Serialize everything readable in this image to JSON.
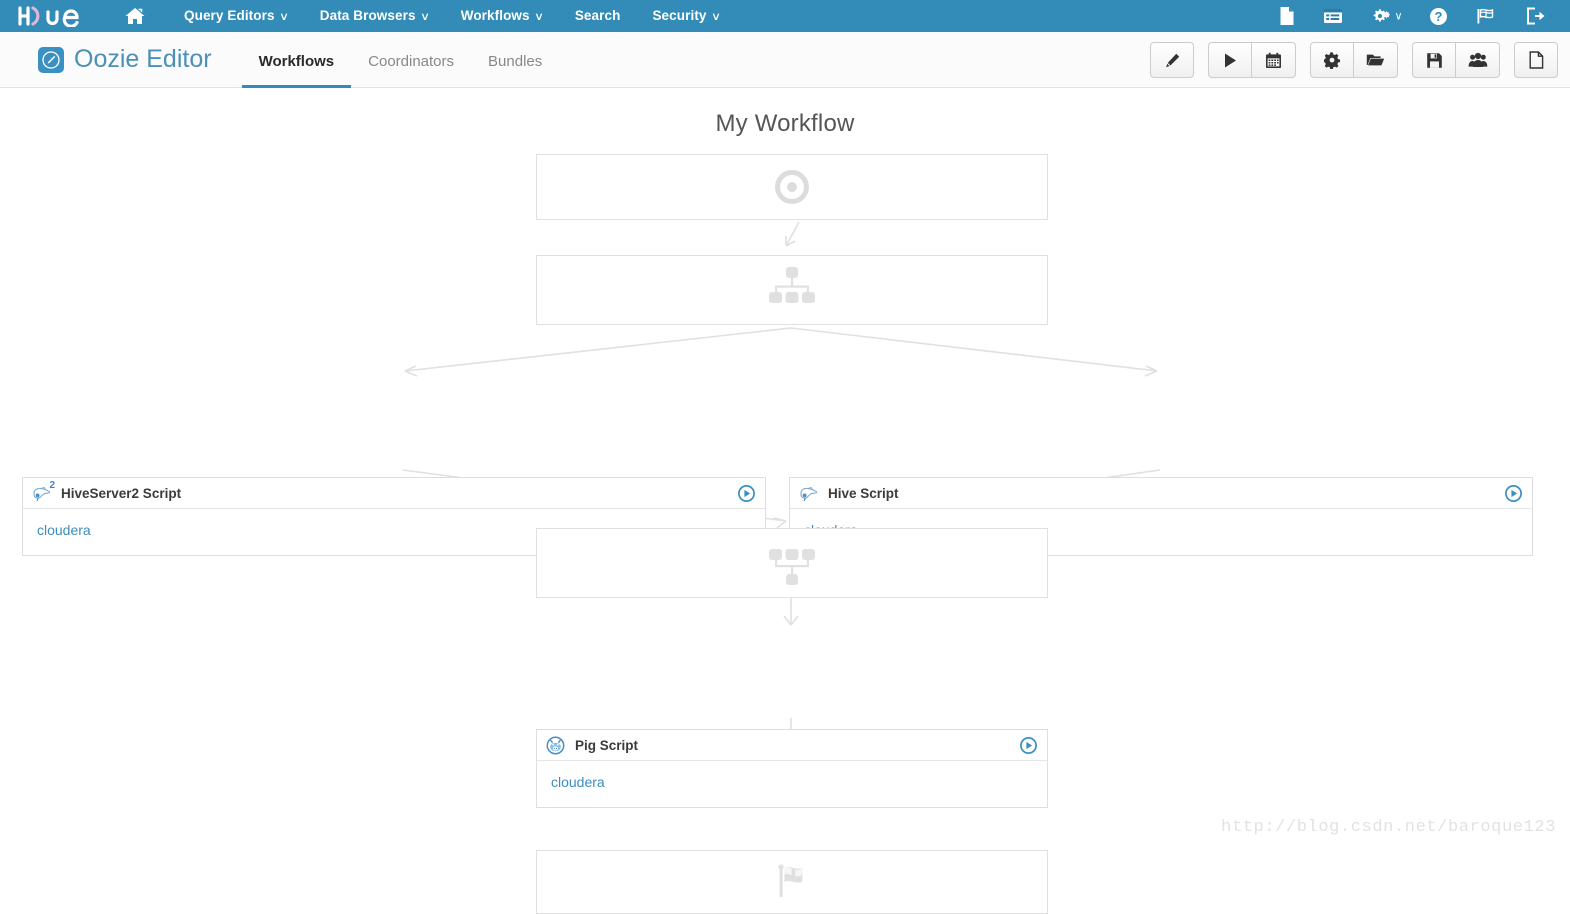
{
  "navbar": {
    "brand_label": "hue",
    "brand_icon": "hue-logo",
    "home_icon": "home-icon",
    "bg_color": "#338bb8",
    "items": [
      {
        "label": "Query Editors",
        "caret": "∨",
        "has_caret": true,
        "icon": "chevron-down-icon"
      },
      {
        "label": "Data Browsers",
        "caret": "∨",
        "has_caret": true,
        "icon": "chevron-down-icon"
      },
      {
        "label": "Workflows",
        "caret": "∨",
        "has_caret": true,
        "icon": "chevron-down-icon"
      },
      {
        "label": "Search",
        "caret": "",
        "has_caret": false,
        "icon": ""
      },
      {
        "label": "Security",
        "caret": "∨",
        "has_caret": true,
        "icon": "chevron-down-icon"
      }
    ],
    "right_icons": [
      {
        "name": "document-icon",
        "title": "Documents"
      },
      {
        "name": "jobs-window-icon",
        "title": "Job Browser"
      },
      {
        "name": "gears-icon",
        "title": "Administration",
        "caret": "∨"
      },
      {
        "name": "help-question-icon",
        "title": "Help"
      },
      {
        "name": "flag-icon",
        "title": "Language"
      },
      {
        "name": "sign-out-icon",
        "title": "Sign out"
      }
    ]
  },
  "subheader": {
    "app_logo_icon": "pencil-square-icon",
    "app_title": "Oozie Editor",
    "app_title_color": "#4a90b8",
    "tabs": [
      {
        "label": "Workflows",
        "active": true
      },
      {
        "label": "Coordinators",
        "active": false
      },
      {
        "label": "Bundles",
        "active": false
      }
    ],
    "toolbar_groups": [
      {
        "buttons": [
          {
            "name": "edit-properties-button",
            "icon": "pencil-icon",
            "label": "Edit"
          }
        ]
      },
      {
        "buttons": [
          {
            "name": "submit-button",
            "icon": "play-icon",
            "label": "Submit"
          },
          {
            "name": "schedule-button",
            "icon": "calendar-icon",
            "label": "Schedule"
          }
        ]
      },
      {
        "buttons": [
          {
            "name": "settings-button",
            "icon": "gear-icon",
            "label": "Settings"
          },
          {
            "name": "open-button",
            "icon": "folder-open-icon",
            "label": "Open"
          }
        ]
      },
      {
        "buttons": [
          {
            "name": "save-button",
            "icon": "floppy-save-icon",
            "label": "Save"
          },
          {
            "name": "share-button",
            "icon": "group-users-icon",
            "label": "Share"
          }
        ]
      },
      {
        "buttons": [
          {
            "name": "new-button",
            "icon": "file-icon",
            "label": "New"
          }
        ]
      }
    ]
  },
  "workflow": {
    "title": "My Workflow",
    "nodes": [
      {
        "id": "start",
        "type": "control",
        "icon": "start-dot-circle-icon",
        "label": ""
      },
      {
        "id": "fork",
        "type": "control",
        "icon": "fork-sitemap-icon",
        "label": ""
      },
      {
        "id": "hiveserver2",
        "type": "action",
        "icon": "hive-server2-icon",
        "name": "HiveServer2 Script",
        "superscript": "2",
        "document": "cloudera",
        "play_icon": "play-circle-icon"
      },
      {
        "id": "hive",
        "type": "action",
        "icon": "hive-icon",
        "name": "Hive Script",
        "superscript": "",
        "document": "cloudera",
        "play_icon": "play-circle-icon"
      },
      {
        "id": "join",
        "type": "control",
        "icon": "join-sitemap-icon",
        "label": ""
      },
      {
        "id": "pig",
        "type": "action",
        "icon": "pig-icon",
        "name": "Pig Script",
        "superscript": "",
        "document": "cloudera",
        "play_icon": "play-circle-icon"
      },
      {
        "id": "end",
        "type": "control",
        "icon": "end-checkered-flag-icon",
        "label": ""
      }
    ]
  },
  "watermark": {
    "text": "http://blog.csdn.net/baroque123"
  }
}
